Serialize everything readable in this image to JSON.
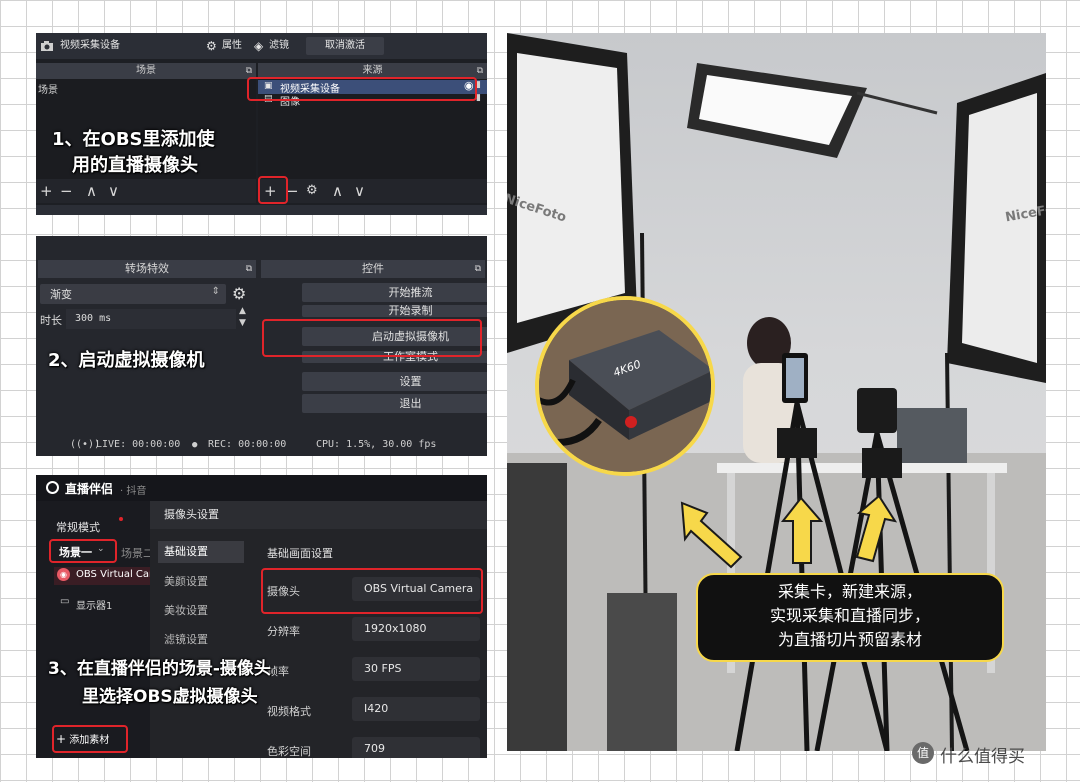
{
  "panel1": {
    "window_title": "视频采集设备",
    "properties_label": "属性",
    "filters_label": "滤镜",
    "deactivate_label": "取消激活",
    "scenes_header": "场景",
    "sources_header": "来源",
    "scene_item": "场景",
    "sources": [
      "视频采集设备",
      "图像"
    ],
    "annotation_line1": "1、在OBS里添加使",
    "annotation_line2": "用的直播摄像头"
  },
  "panel2": {
    "transitions_header": "转场特效",
    "controls_header": "控件",
    "transition_value": "渐变",
    "duration_label": "时长",
    "duration_value": "300 ms",
    "buttons": [
      "开始推流",
      "开始录制",
      "启动虚拟摄像机",
      "工作室模式",
      "设置",
      "退出"
    ],
    "annotation": "2、启动虚拟摄像机",
    "status_live": "LIVE: 00:00:00",
    "status_rec": "REC: 00:00:00",
    "status_cpu": "CPU: 1.5%, 30.00 fps"
  },
  "panel3": {
    "app_name": "直播伴侣",
    "app_sub": "· 抖音",
    "mode_label": "常规模式",
    "scene_tab_active": "场景一",
    "scene_tab_other": "场景二",
    "source_camera": "OBS Virtual Camera",
    "source_display": "显示器1",
    "add_material": "添加素材",
    "dialog_title": "摄像头设置",
    "nav_items": [
      "基础设置",
      "美颜设置",
      "美妆设置",
      "滤镜设置"
    ],
    "section_title": "基础画面设置",
    "fields": [
      {
        "label": "摄像头",
        "value": "OBS Virtual Camera"
      },
      {
        "label": "分辨率",
        "value": "1920x1080"
      },
      {
        "label": "帧率",
        "value": "30 FPS"
      },
      {
        "label": "视频格式",
        "value": "I420"
      },
      {
        "label": "色彩空间",
        "value": "709"
      }
    ],
    "annotation_line1": "3、在直播伴侣的场景-摄像头",
    "annotation_line2": "里选择OBS虚拟摄像头"
  },
  "photo": {
    "softbox_brand": "NiceFoto",
    "capture_card_label": "4K60",
    "bubble_lines": [
      "采集卡，新建来源，",
      "实现采集和直播同步，",
      "为直播切片预留素材"
    ],
    "accent_color": "#f7d84a"
  },
  "watermark": {
    "text": "什么值得买",
    "logo_glyph": "值"
  }
}
